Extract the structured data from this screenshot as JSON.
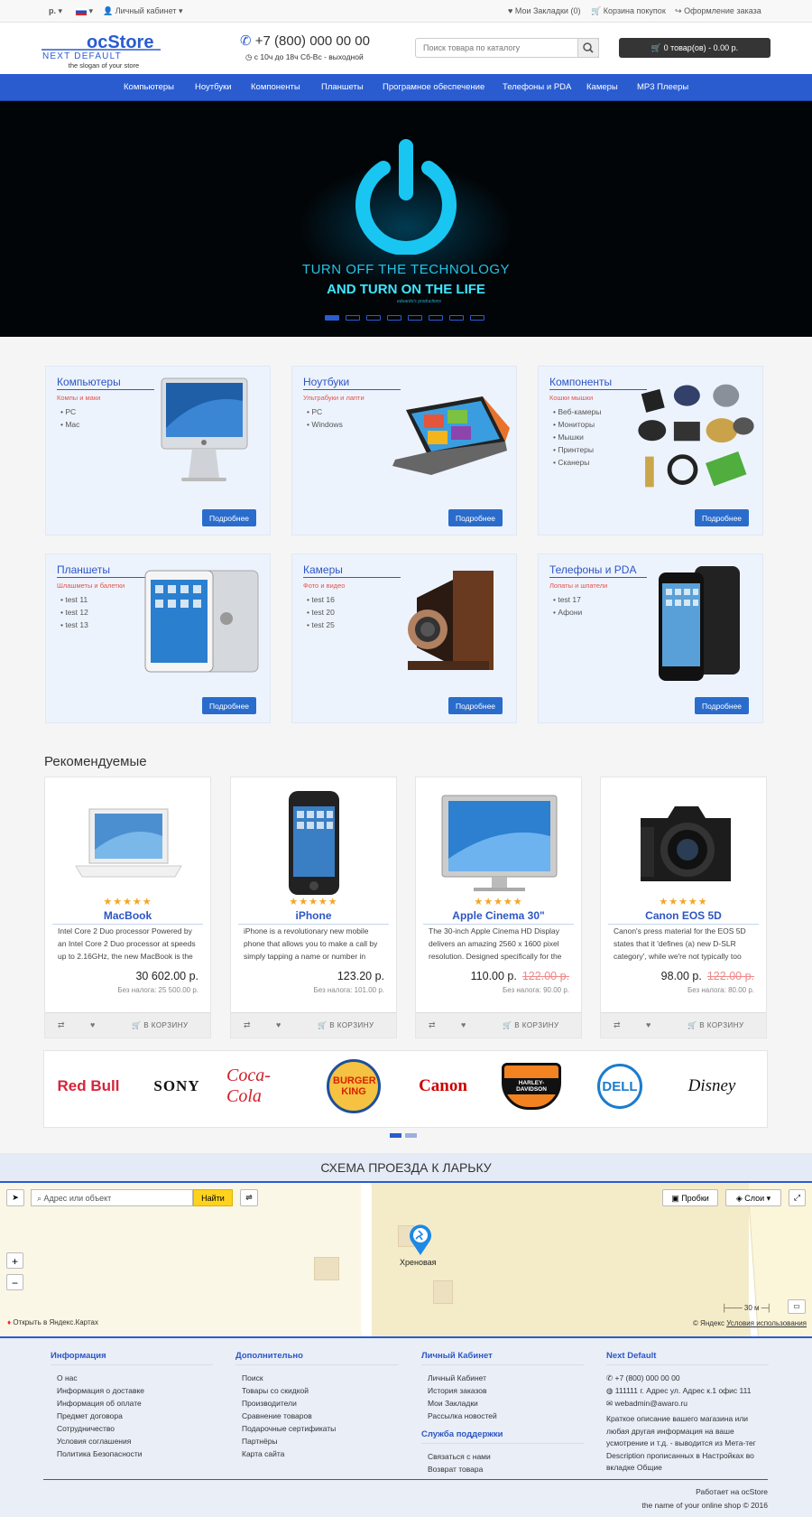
{
  "topbar": {
    "currency": "р.",
    "account": "Личный кабинет",
    "wishlist": "Мои Закладки (0)",
    "cart": "Корзина покупок",
    "checkout": "Оформление заказа"
  },
  "header": {
    "logo_main": "ocStore",
    "logo_sub": "NEXT DEFAULT",
    "slogan": "the slogan of your store",
    "phone": "+7 (800) 000 00 00",
    "hours": "с 10ч до 18ч Сб-Вс - выходной",
    "search_placeholder": "Поиск товара по каталогу",
    "cart_summary": "0 товар(ов) - 0.00 р."
  },
  "nav": [
    "Компьютеры",
    "Ноутбуки",
    "Компоненты",
    "Планшеты",
    "Програмное обеспечение",
    "Телефоны и PDA",
    "Камеры",
    "MP3 Плееры"
  ],
  "banner": {
    "line1": "TURN OFF THE TECHNOLOGY",
    "line2": "AND TURN ON THE LIFE",
    "line3": "eduardo's productions",
    "active_slide": 1,
    "slide_count": 8
  },
  "categories": [
    {
      "title": "Компьютеры",
      "sub": "Компы и маки",
      "items": [
        "PC",
        "Mac"
      ],
      "button": "Подробнее"
    },
    {
      "title": "Ноутбуки",
      "sub": "Ультрабуки и лапти",
      "items": [
        "PC",
        "Windows"
      ],
      "button": "Подробнее"
    },
    {
      "title": "Компоненты",
      "sub": "Кошки мышки",
      "items": [
        "Веб-камеры",
        "Мониторы",
        "Мышки",
        "Принтеры",
        "Сканеры"
      ],
      "button": "Подробнее"
    },
    {
      "title": "Планшеты",
      "sub": "Шлашметы и балетки",
      "items": [
        "test 11",
        "test 12",
        "test 13"
      ],
      "button": "Подробнее"
    },
    {
      "title": "Камеры",
      "sub": "Фото и видео",
      "items": [
        "test 16",
        "test 20",
        "test 25"
      ],
      "button": "Подробнее"
    },
    {
      "title": "Телефоны и PDA",
      "sub": "Лопаты и шпатели",
      "items": [
        "test 17",
        "Афони"
      ],
      "button": "Подробнее"
    }
  ],
  "featured": {
    "title": "Рекомендуемые",
    "cart_label": "В КОРЗИНУ",
    "products": [
      {
        "name": "MacBook",
        "desc": "Intel Core 2 Duo processor Powered by an Intel Core 2 Duo processor at speeds up to 2.16GHz, the new MacBook is the",
        "price": "30 602.00 р.",
        "old": "",
        "tax": "Без налога: 25 500.00 р.",
        "rating": 5
      },
      {
        "name": "iPhone",
        "desc": "iPhone is a revolutionary new mobile phone that allows you to make a call by simply tapping a name or number in",
        "price": "123.20 р.",
        "old": "",
        "tax": "Без налога: 101.00 р.",
        "rating": 5
      },
      {
        "name": "Apple Cinema 30\"",
        "desc": "The 30-inch Apple Cinema HD Display delivers an amazing 2560 x 1600 pixel resolution. Designed specifically for the",
        "price": "110.00 р.",
        "old": "122.00 р.",
        "tax": "Без налога: 90.00 р.",
        "rating": 5
      },
      {
        "name": "Canon EOS 5D",
        "desc": "Canon's press material for the EOS 5D states that it 'defines (a) new D-SLR category', while we're not typically too",
        "price": "98.00 р.",
        "old": "122.00 р.",
        "tax": "Без налога: 80.00 р.",
        "rating": 5
      }
    ]
  },
  "brands": [
    "Red Bull",
    "SONY",
    "Coca-Cola",
    "BURGER KING",
    "Canon",
    "HARLEY-DAVIDSON",
    "DELL",
    "Disney"
  ],
  "map": {
    "title": "СХЕМА ПРОЕЗДА К ЛАРЬКУ",
    "search_placeholder": "Адрес или объект",
    "find": "Найти",
    "traffic": "Пробки",
    "layers": "Слои",
    "place": "Хреновая",
    "scale": "30 м",
    "open_in": "Открыть в Яндекс.Картах",
    "copyright": "© Яндекс",
    "terms": "Условия использования"
  },
  "footer": {
    "info": {
      "title": "Информация",
      "links": [
        "О нас",
        "Информация о доставке",
        "Информация об оплате",
        "Предмет договора",
        "Сотрудничество",
        "Условия соглашения",
        "Политика Безопасности"
      ]
    },
    "extra": {
      "title": "Дополнительно",
      "links": [
        "Поиск",
        "Товары со скидкой",
        "Производители",
        "Сравнение товаров",
        "Подарочные сертификаты",
        "Партнёры",
        "Карта сайта"
      ]
    },
    "account": {
      "title": "Личный Кабинет",
      "links": [
        "Личный Кабинет",
        "История заказов",
        "Мои Закладки",
        "Рассылка новостей"
      ]
    },
    "support": {
      "title": "Служба поддержки",
      "links": [
        "Связаться с нами",
        "Возврат товара"
      ]
    },
    "contact": {
      "title": "Next Default",
      "phone": "+7 (800) 000 00 00",
      "address": "111111 г. Адрес ул. Адрес к.1 офис 111",
      "email": "webadmin@awaro.ru",
      "desc": "Краткое описание вашего магазина или любая другая информация на ваше усмотрение и т.д. - выводится из Мета-тег Description прописанных в Настройках во вкладке Общие"
    },
    "powered": "Работает на ocStore",
    "copyright": "the name of your online shop © 2016"
  },
  "colors": {
    "accent": "#2a5cd0",
    "button": "#2a6ccc",
    "price_old": "#e88888",
    "star": "#f5a623"
  }
}
